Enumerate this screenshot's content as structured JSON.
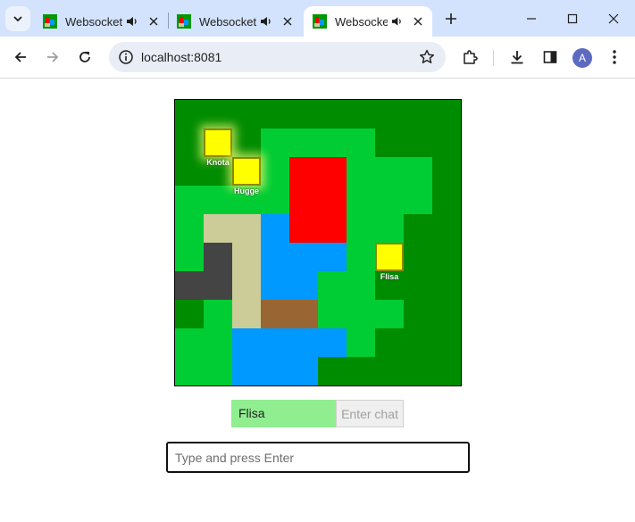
{
  "tabs": [
    {
      "title": "Websocket",
      "active": false
    },
    {
      "title": "Websocket",
      "active": false
    },
    {
      "title": "Websocket",
      "active": true
    }
  ],
  "address_bar": {
    "url": "localhost:8081"
  },
  "profile": {
    "initial": "A"
  },
  "game": {
    "colors": {
      "dark_grass": "#008c00",
      "grass": "#00cc33",
      "water": "#0099ff",
      "lava": "#ff0000",
      "sand": "#cccc99",
      "rock": "#444444",
      "dirt": "#996633",
      "player": "#ffff00"
    },
    "grid_size": 10,
    "tiles": [
      "DDDDDDDDDD",
      "DDDGGGGDDD",
      "DDDGLLGGGD",
      "GGGGLLGGGD",
      "GSSWLLGGDD",
      "GRSWWWGDDD",
      "RRSWWGGDDD",
      "DGSTTGGGDD",
      "GGWWWWGDDD",
      "GGWWWDDDDD"
    ],
    "players": [
      {
        "name": "Knota",
        "col": 1,
        "row": 1,
        "glow": true
      },
      {
        "name": "Hugge",
        "col": 2,
        "row": 2,
        "glow": true
      },
      {
        "name": "Flisa",
        "col": 7,
        "row": 5,
        "glow": false
      }
    ]
  },
  "chat": {
    "player_name": "Flisa",
    "button_label": "Enter chat",
    "input_placeholder": "Type and press Enter"
  }
}
